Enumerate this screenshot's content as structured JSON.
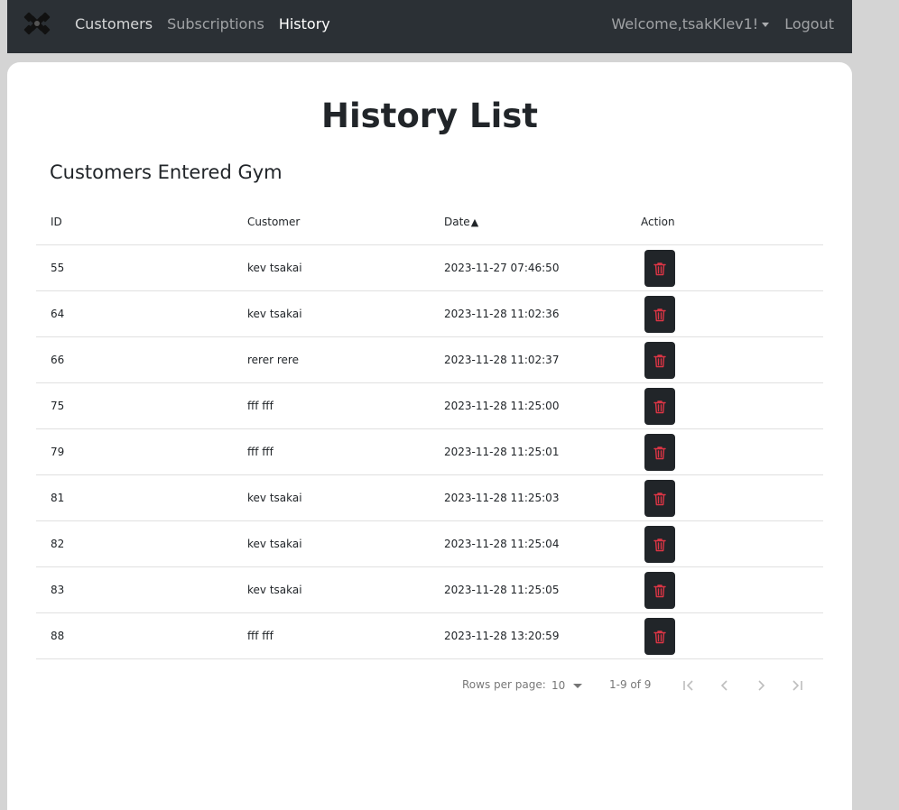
{
  "navbar": {
    "links": [
      {
        "label": "Customers"
      },
      {
        "label": "Subscriptions"
      },
      {
        "label": "History"
      }
    ],
    "welcome": "Welcome,tsakKlev1!",
    "logout": "Logout"
  },
  "page": {
    "title": "History List",
    "subtitle": "Customers Entered Gym"
  },
  "table": {
    "headers": {
      "id": "ID",
      "customer": "Customer",
      "date": "Date",
      "action": "Action"
    },
    "sort_indicator": "▲",
    "rows": [
      {
        "id": "55",
        "customer": "kev tsakai",
        "date": "2023-11-27 07:46:50"
      },
      {
        "id": "64",
        "customer": "kev tsakai",
        "date": "2023-11-28 11:02:36"
      },
      {
        "id": "66",
        "customer": "rerer rere",
        "date": "2023-11-28 11:02:37"
      },
      {
        "id": "75",
        "customer": "fff fff",
        "date": "2023-11-28 11:25:00"
      },
      {
        "id": "79",
        "customer": "fff fff",
        "date": "2023-11-28 11:25:01"
      },
      {
        "id": "81",
        "customer": "kev tsakai",
        "date": "2023-11-28 11:25:03"
      },
      {
        "id": "82",
        "customer": "kev tsakai",
        "date": "2023-11-28 11:25:04"
      },
      {
        "id": "83",
        "customer": "kev tsakai",
        "date": "2023-11-28 11:25:05"
      },
      {
        "id": "88",
        "customer": "fff fff",
        "date": "2023-11-28 13:20:59"
      }
    ],
    "action_icon": "trash-icon"
  },
  "pagination": {
    "rows_per_page_label": "Rows per page:",
    "rows_per_page_value": "10",
    "range": "1-9 of 9"
  },
  "colors": {
    "navbar_bg": "#2b3035",
    "delete_button_bg": "#212529",
    "delete_icon": "#dc3545"
  }
}
